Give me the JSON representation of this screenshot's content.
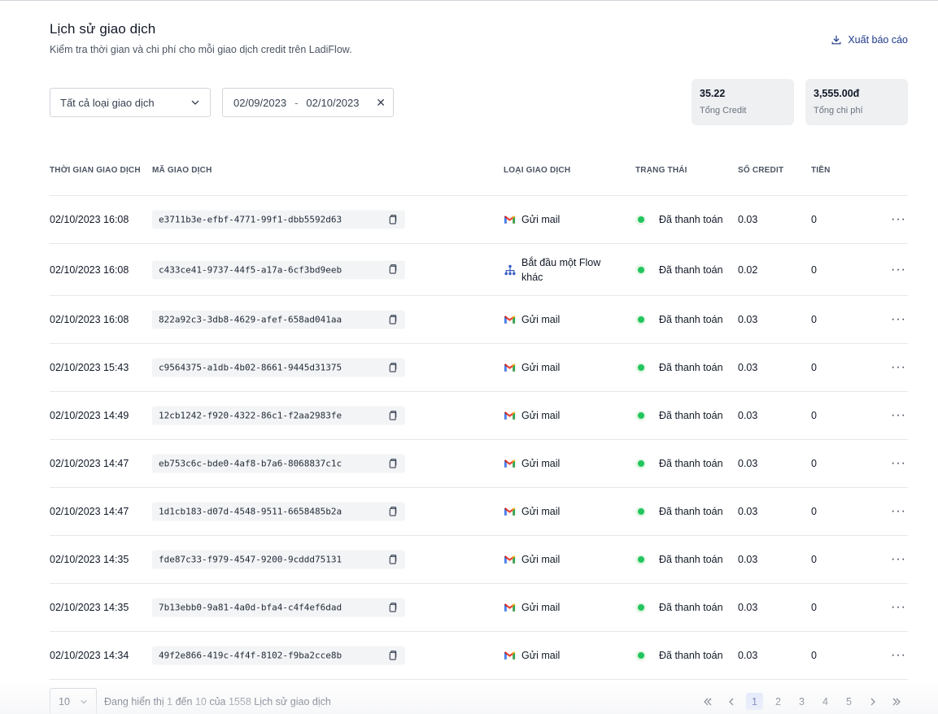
{
  "header": {
    "title": "Lịch sử giao dịch",
    "subtitle": "Kiểm tra thời gian và chi phí cho mỗi giao dịch credit trên LadiFlow.",
    "export_label": "Xuất báo cáo"
  },
  "filters": {
    "type_select": "Tất cả loại giao dịch",
    "date_from": "02/09/2023",
    "date_sep": "-",
    "date_to": "02/10/2023",
    "clear_symbol": "✕"
  },
  "stats": {
    "credit_value": "35.22",
    "credit_label": "Tổng Credit",
    "cost_value": "3,555.00đ",
    "cost_label": "Tổng chi phí"
  },
  "table": {
    "headers": {
      "time": "THỜI GIAN GIAO DỊCH",
      "code": "MÃ GIAO DỊCH",
      "type": "LOẠI GIAO DỊCH",
      "status": "TRẠNG THÁI",
      "credit": "SỐ CREDIT",
      "money": "TIỀN"
    },
    "more_symbol": "···",
    "rows": [
      {
        "time": "02/10/2023 16:08",
        "code": "e3711b3e-efbf-4771-99f1-dbb5592d63",
        "type": "Gửi mail",
        "type_icon": "gmail-icon",
        "status": "Đã thanh toán",
        "credit": "0.03",
        "money": "0"
      },
      {
        "time": "02/10/2023 16:08",
        "code": "c433ce41-9737-44f5-a17a-6cf3bd9eeb",
        "type": "Bắt đầu một Flow khác",
        "type_icon": "flow-icon",
        "status": "Đã thanh toán",
        "credit": "0.02",
        "money": "0"
      },
      {
        "time": "02/10/2023 16:08",
        "code": "822a92c3-3db8-4629-afef-658ad041aa",
        "type": "Gửi mail",
        "type_icon": "gmail-icon",
        "status": "Đã thanh toán",
        "credit": "0.03",
        "money": "0"
      },
      {
        "time": "02/10/2023 15:43",
        "code": "c9564375-a1db-4b02-8661-9445d31375",
        "type": "Gửi mail",
        "type_icon": "gmail-icon",
        "status": "Đã thanh toán",
        "credit": "0.03",
        "money": "0"
      },
      {
        "time": "02/10/2023 14:49",
        "code": "12cb1242-f920-4322-86c1-f2aa2983fe",
        "type": "Gửi mail",
        "type_icon": "gmail-icon",
        "status": "Đã thanh toán",
        "credit": "0.03",
        "money": "0"
      },
      {
        "time": "02/10/2023 14:47",
        "code": "eb753c6c-bde0-4af8-b7a6-8068837c1c",
        "type": "Gửi mail",
        "type_icon": "gmail-icon",
        "status": "Đã thanh toán",
        "credit": "0.03",
        "money": "0"
      },
      {
        "time": "02/10/2023 14:47",
        "code": "1d1cb183-d07d-4548-9511-6658485b2a",
        "type": "Gửi mail",
        "type_icon": "gmail-icon",
        "status": "Đã thanh toán",
        "credit": "0.03",
        "money": "0"
      },
      {
        "time": "02/10/2023 14:35",
        "code": "fde87c33-f979-4547-9200-9cddd75131",
        "type": "Gửi mail",
        "type_icon": "gmail-icon",
        "status": "Đã thanh toán",
        "credit": "0.03",
        "money": "0"
      },
      {
        "time": "02/10/2023 14:35",
        "code": "7b13ebb0-9a81-4a0d-bfa4-c4f4ef6dad",
        "type": "Gửi mail",
        "type_icon": "gmail-icon",
        "status": "Đã thanh toán",
        "credit": "0.03",
        "money": "0"
      },
      {
        "time": "02/10/2023 14:34",
        "code": "49f2e866-419c-4f4f-8102-f9ba2cce8b",
        "type": "Gửi mail",
        "type_icon": "gmail-icon",
        "status": "Đã thanh toán",
        "credit": "0.03",
        "money": "0"
      }
    ]
  },
  "footer": {
    "page_size": "10",
    "showing_prefix": "Đang hiển thị",
    "showing_from": "1",
    "showing_to_word": "đến",
    "showing_to": "10",
    "showing_of_word": "của",
    "showing_total": "1558",
    "showing_suffix": "Lịch sử giao dịch",
    "pages": [
      "1",
      "2",
      "3",
      "4",
      "5"
    ],
    "current_page": "1"
  },
  "colors": {
    "accent": "#1e3a8a",
    "status_green": "#22c55e",
    "stat_bg": "#eef0f2"
  }
}
